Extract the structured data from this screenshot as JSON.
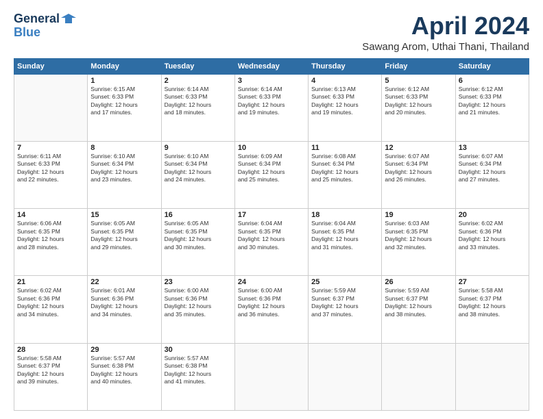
{
  "header": {
    "logo_line1": "General",
    "logo_line2": "Blue",
    "month": "April 2024",
    "location": "Sawang Arom, Uthai Thani, Thailand"
  },
  "days_of_week": [
    "Sunday",
    "Monday",
    "Tuesday",
    "Wednesday",
    "Thursday",
    "Friday",
    "Saturday"
  ],
  "weeks": [
    [
      {
        "day": "",
        "info": ""
      },
      {
        "day": "1",
        "info": "Sunrise: 6:15 AM\nSunset: 6:33 PM\nDaylight: 12 hours\nand 17 minutes."
      },
      {
        "day": "2",
        "info": "Sunrise: 6:14 AM\nSunset: 6:33 PM\nDaylight: 12 hours\nand 18 minutes."
      },
      {
        "day": "3",
        "info": "Sunrise: 6:14 AM\nSunset: 6:33 PM\nDaylight: 12 hours\nand 19 minutes."
      },
      {
        "day": "4",
        "info": "Sunrise: 6:13 AM\nSunset: 6:33 PM\nDaylight: 12 hours\nand 19 minutes."
      },
      {
        "day": "5",
        "info": "Sunrise: 6:12 AM\nSunset: 6:33 PM\nDaylight: 12 hours\nand 20 minutes."
      },
      {
        "day": "6",
        "info": "Sunrise: 6:12 AM\nSunset: 6:33 PM\nDaylight: 12 hours\nand 21 minutes."
      }
    ],
    [
      {
        "day": "7",
        "info": "Sunrise: 6:11 AM\nSunset: 6:33 PM\nDaylight: 12 hours\nand 22 minutes."
      },
      {
        "day": "8",
        "info": "Sunrise: 6:10 AM\nSunset: 6:34 PM\nDaylight: 12 hours\nand 23 minutes."
      },
      {
        "day": "9",
        "info": "Sunrise: 6:10 AM\nSunset: 6:34 PM\nDaylight: 12 hours\nand 24 minutes."
      },
      {
        "day": "10",
        "info": "Sunrise: 6:09 AM\nSunset: 6:34 PM\nDaylight: 12 hours\nand 25 minutes."
      },
      {
        "day": "11",
        "info": "Sunrise: 6:08 AM\nSunset: 6:34 PM\nDaylight: 12 hours\nand 25 minutes."
      },
      {
        "day": "12",
        "info": "Sunrise: 6:07 AM\nSunset: 6:34 PM\nDaylight: 12 hours\nand 26 minutes."
      },
      {
        "day": "13",
        "info": "Sunrise: 6:07 AM\nSunset: 6:34 PM\nDaylight: 12 hours\nand 27 minutes."
      }
    ],
    [
      {
        "day": "14",
        "info": "Sunrise: 6:06 AM\nSunset: 6:35 PM\nDaylight: 12 hours\nand 28 minutes."
      },
      {
        "day": "15",
        "info": "Sunrise: 6:05 AM\nSunset: 6:35 PM\nDaylight: 12 hours\nand 29 minutes."
      },
      {
        "day": "16",
        "info": "Sunrise: 6:05 AM\nSunset: 6:35 PM\nDaylight: 12 hours\nand 30 minutes."
      },
      {
        "day": "17",
        "info": "Sunrise: 6:04 AM\nSunset: 6:35 PM\nDaylight: 12 hours\nand 30 minutes."
      },
      {
        "day": "18",
        "info": "Sunrise: 6:04 AM\nSunset: 6:35 PM\nDaylight: 12 hours\nand 31 minutes."
      },
      {
        "day": "19",
        "info": "Sunrise: 6:03 AM\nSunset: 6:35 PM\nDaylight: 12 hours\nand 32 minutes."
      },
      {
        "day": "20",
        "info": "Sunrise: 6:02 AM\nSunset: 6:36 PM\nDaylight: 12 hours\nand 33 minutes."
      }
    ],
    [
      {
        "day": "21",
        "info": "Sunrise: 6:02 AM\nSunset: 6:36 PM\nDaylight: 12 hours\nand 34 minutes."
      },
      {
        "day": "22",
        "info": "Sunrise: 6:01 AM\nSunset: 6:36 PM\nDaylight: 12 hours\nand 34 minutes."
      },
      {
        "day": "23",
        "info": "Sunrise: 6:00 AM\nSunset: 6:36 PM\nDaylight: 12 hours\nand 35 minutes."
      },
      {
        "day": "24",
        "info": "Sunrise: 6:00 AM\nSunset: 6:36 PM\nDaylight: 12 hours\nand 36 minutes."
      },
      {
        "day": "25",
        "info": "Sunrise: 5:59 AM\nSunset: 6:37 PM\nDaylight: 12 hours\nand 37 minutes."
      },
      {
        "day": "26",
        "info": "Sunrise: 5:59 AM\nSunset: 6:37 PM\nDaylight: 12 hours\nand 38 minutes."
      },
      {
        "day": "27",
        "info": "Sunrise: 5:58 AM\nSunset: 6:37 PM\nDaylight: 12 hours\nand 38 minutes."
      }
    ],
    [
      {
        "day": "28",
        "info": "Sunrise: 5:58 AM\nSunset: 6:37 PM\nDaylight: 12 hours\nand 39 minutes."
      },
      {
        "day": "29",
        "info": "Sunrise: 5:57 AM\nSunset: 6:38 PM\nDaylight: 12 hours\nand 40 minutes."
      },
      {
        "day": "30",
        "info": "Sunrise: 5:57 AM\nSunset: 6:38 PM\nDaylight: 12 hours\nand 41 minutes."
      },
      {
        "day": "",
        "info": ""
      },
      {
        "day": "",
        "info": ""
      },
      {
        "day": "",
        "info": ""
      },
      {
        "day": "",
        "info": ""
      }
    ]
  ]
}
